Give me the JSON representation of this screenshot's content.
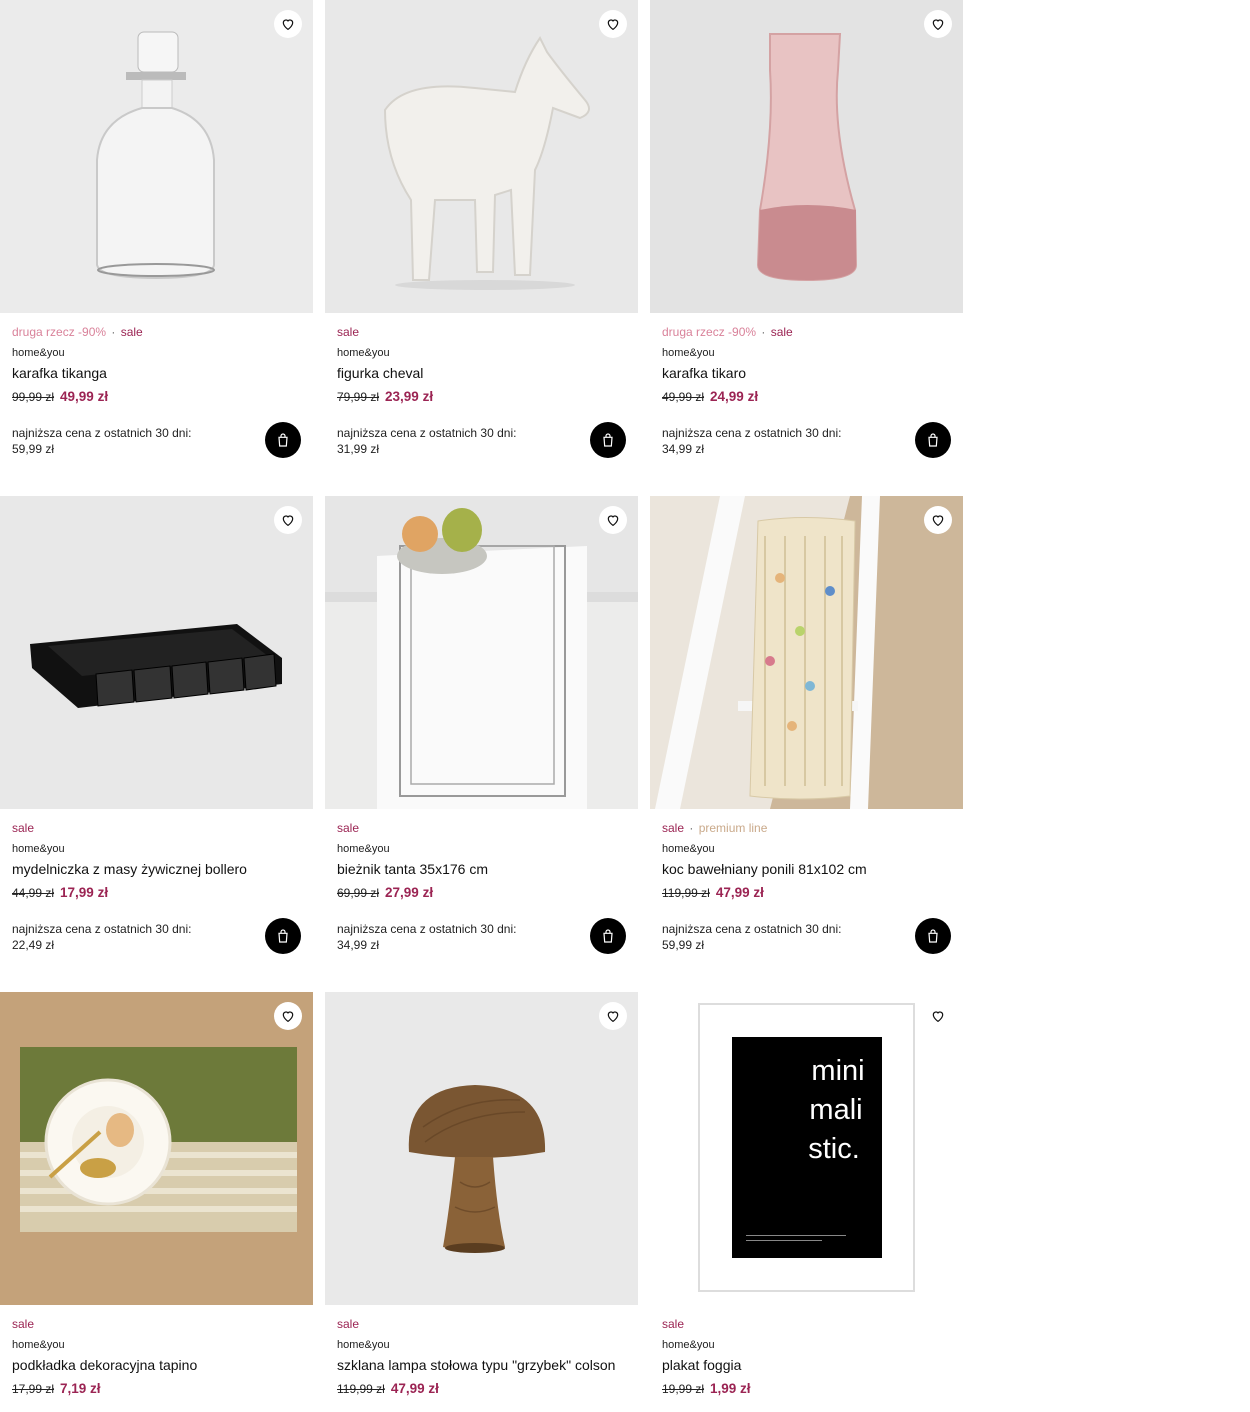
{
  "colors": {
    "sale": "#9b2453",
    "promo": "#d9829a",
    "premium": "#c9a98a"
  },
  "products": [
    {
      "promo": "druga rzecz -90%",
      "sale": "sale",
      "premium": "",
      "brand": "home&you",
      "name": "karafka tikanga",
      "old_price": "99,99 zł",
      "new_price": "49,99 zł",
      "lowest_label": "najniższa cena z ostatnich 30 dni:",
      "lowest_value": "59,99 zł",
      "image": "glass-carafe-image"
    },
    {
      "promo": "",
      "sale": "sale",
      "premium": "",
      "brand": "home&you",
      "name": "figurka cheval",
      "old_price": "79,99 zł",
      "new_price": "23,99 zł",
      "lowest_label": "najniższa cena z ostatnich 30 dni:",
      "lowest_value": "31,99 zł",
      "image": "horse-figurine-image"
    },
    {
      "promo": "druga rzecz -90%",
      "sale": "sale",
      "premium": "",
      "brand": "home&you",
      "name": "karafka tikaro",
      "old_price": "49,99 zł",
      "new_price": "24,99 zł",
      "lowest_label": "najniższa cena z ostatnich 30 dni:",
      "lowest_value": "34,99 zł",
      "image": "pink-carafe-image"
    },
    {
      "promo": "",
      "sale": "sale",
      "premium": "",
      "brand": "home&you",
      "name": "mydelniczka z masy żywicznej bollero",
      "old_price": "44,99 zł",
      "new_price": "17,99 zł",
      "lowest_label": "najniższa cena z ostatnich 30 dni:",
      "lowest_value": "22,49 zł",
      "image": "soap-dish-image"
    },
    {
      "promo": "",
      "sale": "sale",
      "premium": "",
      "brand": "home&you",
      "name": "bieżnik tanta 35x176 cm",
      "old_price": "69,99 zł",
      "new_price": "27,99 zł",
      "lowest_label": "najniższa cena z ostatnich 30 dni:",
      "lowest_value": "34,99 zł",
      "image": "table-runner-image"
    },
    {
      "promo": "",
      "sale": "sale",
      "premium": "premium line",
      "brand": "home&you",
      "name": "koc bawełniany ponili 81x102 cm",
      "old_price": "119,99 zł",
      "new_price": "47,99 zł",
      "lowest_label": "najniższa cena z ostatnich 30 dni:",
      "lowest_value": "59,99 zł",
      "image": "blanket-ladder-image"
    },
    {
      "promo": "",
      "sale": "sale",
      "premium": "",
      "brand": "home&you",
      "name": "podkładka dekoracyjna tapino",
      "old_price": "17,99 zł",
      "new_price": "7,19 zł",
      "lowest_label": "",
      "lowest_value": "",
      "image": "placemat-image"
    },
    {
      "promo": "",
      "sale": "sale",
      "premium": "",
      "brand": "home&you",
      "name": "szklana lampa stołowa typu \"grzybek\" colson",
      "old_price": "119,99 zł",
      "new_price": "47,99 zł",
      "lowest_label": "",
      "lowest_value": "",
      "image": "mushroom-lamp-image"
    },
    {
      "promo": "",
      "sale": "sale",
      "premium": "",
      "brand": "home&you",
      "name": "plakat foggia",
      "old_price": "19,99 zł",
      "new_price": "1,99 zł",
      "lowest_label": "",
      "lowest_value": "",
      "image": "poster-image",
      "poster_text": [
        "mini",
        "mali",
        "stic."
      ]
    }
  ]
}
